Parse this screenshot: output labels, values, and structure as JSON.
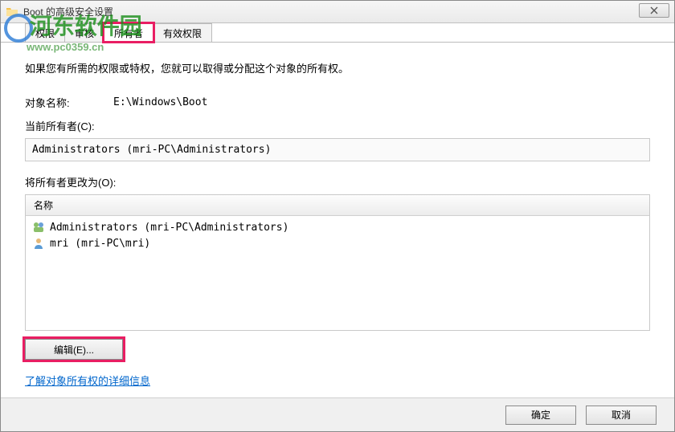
{
  "window": {
    "title": "Boot 的高级安全设置"
  },
  "watermark": "河东软件园",
  "watermark_sub": "www.pc0359.cn",
  "tabs": {
    "permissions": "权限",
    "auditing": "审核",
    "owner": "所有者",
    "effective": "有效权限"
  },
  "body": {
    "description": "如果您有所需的权限或特权，您就可以取得或分配这个对象的所有权。",
    "object_name_label": "对象名称:",
    "object_name_value": "E:\\Windows\\Boot",
    "current_owner_label": "当前所有者(C):",
    "current_owner_value": "Administrators (mri-PC\\Administrators)",
    "change_owner_label": "将所有者更改为(O):",
    "list_header": "名称",
    "owners": [
      {
        "type": "group",
        "text": "Administrators (mri-PC\\Administrators)"
      },
      {
        "type": "user",
        "text": "mri (mri-PC\\mri)"
      }
    ],
    "edit_button": "编辑(E)...",
    "learn_more": "了解对象所有权的详细信息"
  },
  "footer": {
    "ok": "确定",
    "cancel": "取消"
  }
}
